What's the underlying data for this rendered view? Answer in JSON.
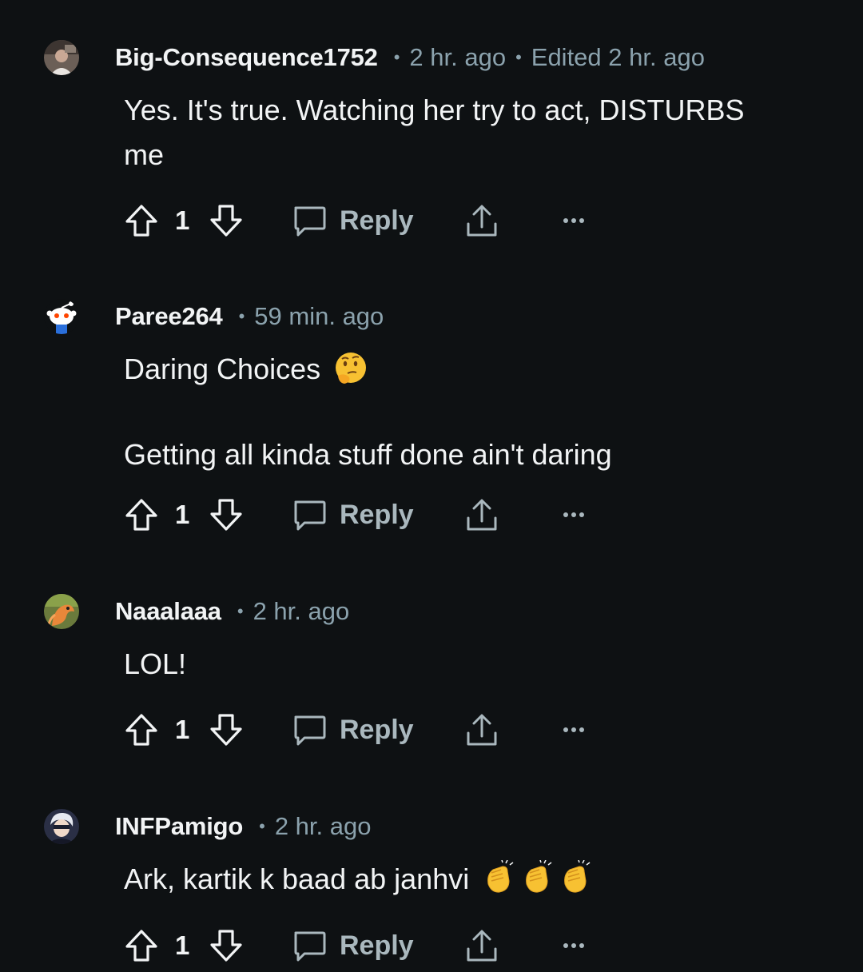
{
  "comments": [
    {
      "username": "Big-Consequence1752",
      "time": "2 hr. ago",
      "edited": "Edited 2 hr. ago",
      "body": [
        "Yes. It's true. Watching her try to act, DISTURBS me"
      ],
      "votes": "1",
      "reply_label": "Reply",
      "avatar_icon": "user-photo-avatar"
    },
    {
      "username": "Paree264",
      "time": "59 min. ago",
      "edited": "",
      "body": [
        "Daring Choices",
        "Getting all kinda stuff done ain't daring"
      ],
      "body_emoji": "thinking-face-emoji",
      "votes": "1",
      "reply_label": "Reply",
      "avatar_icon": "snoo-avatar"
    },
    {
      "username": "Naaalaaa",
      "time": "2 hr. ago",
      "edited": "",
      "body": [
        "LOL!"
      ],
      "votes": "1",
      "reply_label": "Reply",
      "avatar_icon": "dragon-avatar"
    },
    {
      "username": "INFPamigo",
      "time": "2 hr. ago",
      "edited": "",
      "body": [
        "Ark, kartik k baad ab janhvi"
      ],
      "body_emoji": "clapping-hands-emoji-x3",
      "votes": "1",
      "reply_label": "Reply",
      "avatar_icon": "anime-character-avatar"
    }
  ],
  "colors": {
    "background": "#0e1113",
    "text": "#f2f4f5",
    "meta": "#8ba2ad",
    "action": "#aab8be"
  }
}
